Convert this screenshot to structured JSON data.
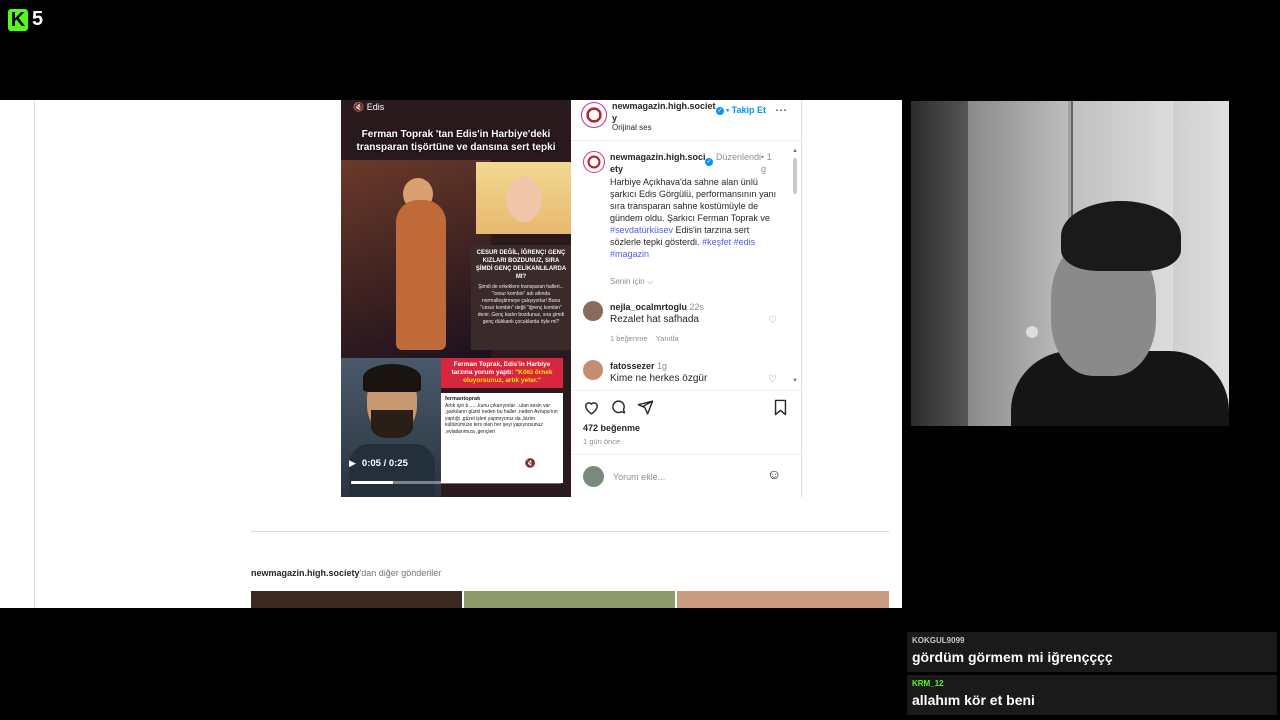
{
  "stream": {
    "logo_letter": "K",
    "logo_number": "5"
  },
  "video": {
    "top_label": "Edis",
    "title": "Ferman Toprak 'tan Edis'in Harbiye'deki transparan tişörtüne ve dansına sert tepki",
    "quote_headline": "CESUR DEĞİL, İĞRENÇ! GENÇ KIZLARI BOZDUNUZ, SIRA ŞİMDİ GENÇ DELİKANLILARDA MI?",
    "quote_body": "Şimdi de erkeklere transparan halleri... \"cesur kombin\" adı altında normalleştirmeye çalışıyorlar! Buna \"cesur kombin\" değil \"iğrenç kombin\" denir. Genç kadın bozdunuz, sıra şimdi genç dükkanlı çocuklarda öyle mi?",
    "red_banner_main": "Ferman Toprak, Edis'in Harbiye tarzına yorum yaptı:",
    "red_banner_quote": "\"Kötü örnek oluyorsunuz, artık yeter.\"",
    "card_user": "fermantoprak",
    "card_text": "Artık için b.......kunu çıkarıyorlar ..ulan sesin var ,şarkıların güzel neden bu haller ,neden Avrupa'nın yaptığı ,güzel işleri yapmıyoruz da ,bizim kültürümüze ters olan her şeyi yapıyorsunuz ,evlatlarımıza ,gençleri",
    "time": "0:05 / 0:25",
    "progress": 0.2
  },
  "post": {
    "header_user": "newmagazin.high.society",
    "follow_label": "Takip Et",
    "sound_label": "Orijinal ses",
    "caption_user": "newmagazin.high.society",
    "edited_label": "Düzenlendi",
    "caption_time": "1 g",
    "caption_text": "Harbiye Açıkhava'da sahne alan ünlü şarkıcı Edis Görgülü, performansının yanı sıra transparan sahne kostümüyle de gündem oldu. Şarkıcı Ferman Toprak ve",
    "caption_mention": "#sevdatürküsev",
    "caption_text2": " Edis'in tarzına sert sözlerle tepki gösterdi.",
    "caption_tags": "#keşfet #edis #magazin",
    "for_you_label": "Senin için",
    "comments": [
      {
        "user": "nejla_ocalmrtoglu",
        "time": "22s",
        "text": "Rezalet hat safhada",
        "likes": "1 beğenme",
        "reply": "Yanıtla"
      },
      {
        "user": "fatossezer",
        "time": "1g",
        "text": "Kime ne herkes özgür"
      }
    ],
    "like_count": "472 beğenme",
    "date": "1 gün önce",
    "comment_placeholder": "Yorum ekle..."
  },
  "more_posts": {
    "user": "newmagazin.high.society",
    "suffix": "'dan diğer gönderiler"
  },
  "chat": [
    {
      "user": "KOKGUL9099",
      "message": "gördüm görmem mi iğrençççç",
      "color": "#c8c8c8"
    },
    {
      "user": "KRM_12",
      "message": "allahım kör et beni",
      "color": "#53fc18"
    }
  ]
}
